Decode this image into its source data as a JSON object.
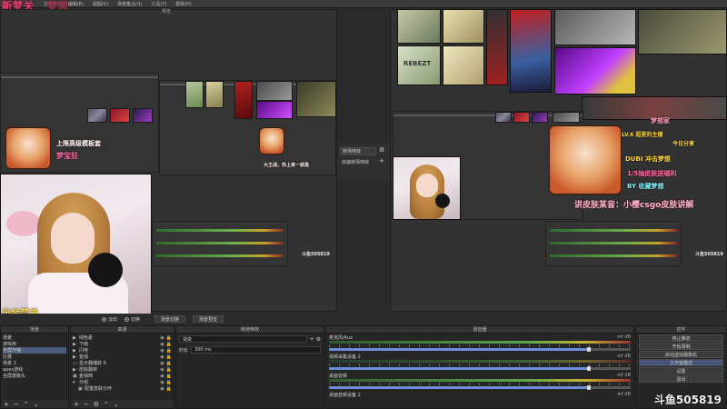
{
  "overlay": {
    "title_main": "新梦关",
    "title_sub": "梦想",
    "top_right_name": "梦想家",
    "flag_text": "出金菜单",
    "dy_bottom": "斗鱼505819",
    "dy_preview": "斗鱼505819",
    "dy_program": "斗鱼505819",
    "pink_line_1": "上限高级模板套",
    "pink_line_2": "梦宝狂",
    "pink_line_3": "大王战，你上来一就是",
    "right_line_1": "LV.6 超星的主播",
    "right_line_2": "今日分享",
    "right_line_3": "DUBI 冲击梦想",
    "right_line_4": "1/5抽皮肤送福利",
    "right_line_5": "BY 收藏梦想",
    "right_line_6": "讲皮肤某音：小樱csgo皮肤讲解",
    "weapon_text": "REBEZT"
  },
  "menu": {
    "items": [
      "文件(F)",
      "编辑(E)",
      "视图(V)",
      "场景集合(S)",
      "工具(T)",
      "帮助(H)"
    ],
    "preview_label": "预览"
  },
  "transition": {
    "quick_label": "转场特效",
    "quick_label_2": "快速转场特效"
  },
  "modebar": {
    "radio_fade": "淡出",
    "radio_cut": "切换",
    "btn_1": "场景切换",
    "btn_2": "场景预览"
  },
  "scenes": {
    "header": "场景",
    "items": [
      "场景",
      "游戏用",
      "全屏开播",
      "比赛",
      "场景 2",
      "apex游戏",
      "全屏摄像头"
    ],
    "selected_index": 2
  },
  "sources": {
    "header": "来源",
    "items": [
      {
        "name": "绿色素"
      },
      {
        "name": "下雨"
      },
      {
        "name": "闪电"
      },
      {
        "name": "金钱"
      },
      {
        "name": "显示器捕获 6"
      },
      {
        "name": "皮肤翻转"
      },
      {
        "name": "金钱西"
      },
      {
        "name": "分组"
      },
      {
        "name": "配置皮肤分环"
      }
    ]
  },
  "transitions_dock": {
    "header": "转场特效",
    "type": "渐变",
    "duration_label": "时长",
    "duration_value": "300 ms"
  },
  "mixer": {
    "header": "混音器",
    "channels": [
      {
        "name": "麦克风/Aux",
        "db": "-inf dB",
        "level": 0.86
      },
      {
        "name": "视频采集设备 2",
        "db": "-inf dB",
        "level": 0.86
      },
      {
        "name": "桌面音频",
        "db": "-inf dB",
        "level": 0.86
      },
      {
        "name": "桌面音频设备 2",
        "db": "-inf dB",
        "level": 0.86
      }
    ]
  },
  "controls": {
    "header": "控件",
    "buttons": [
      "停止推流",
      "开始录制",
      "启动虚拟摄像机",
      "工作室模式",
      "设置",
      "退出"
    ],
    "active_index": 3
  },
  "colors": {
    "accent": "#e0407a",
    "selection": "#4a5a78",
    "panel": "#262626"
  }
}
